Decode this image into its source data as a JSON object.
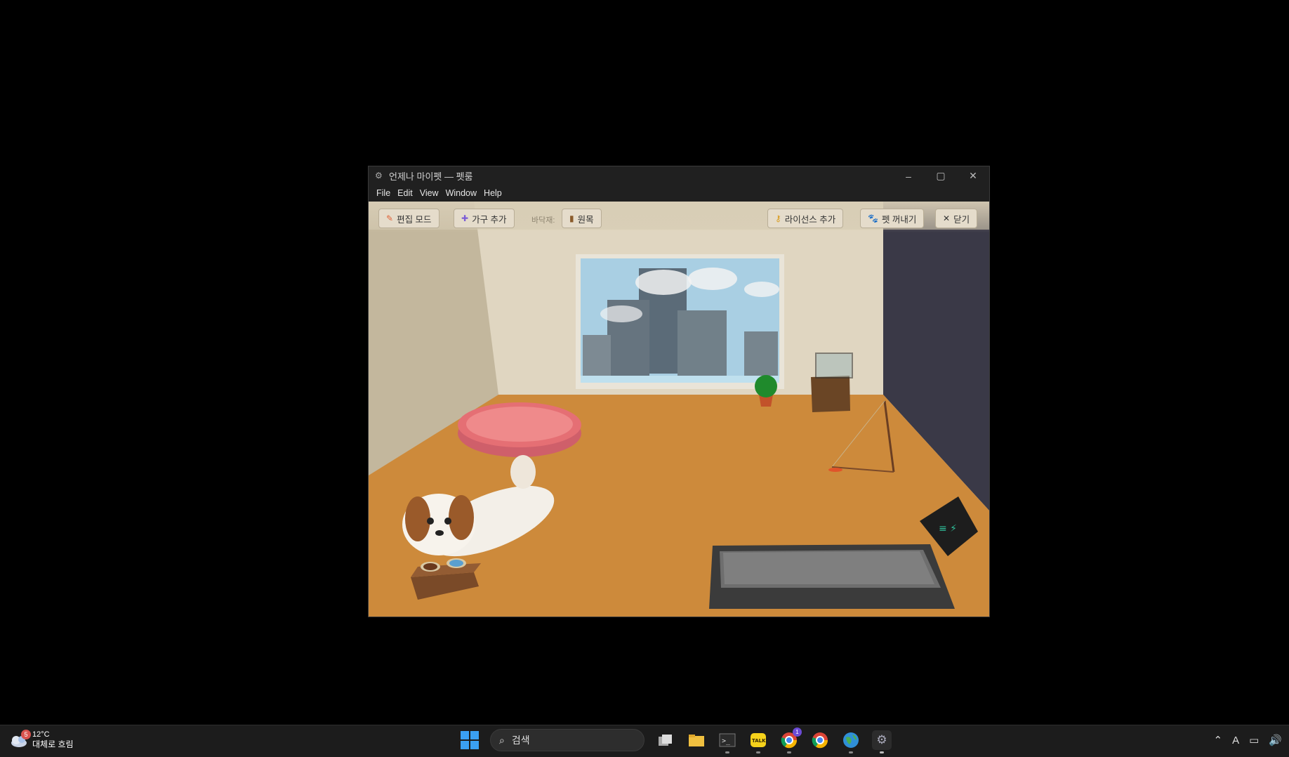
{
  "window": {
    "title": "언제나 마이펫 — 펫룸",
    "menu": [
      "File",
      "Edit",
      "View",
      "Window",
      "Help"
    ],
    "controls": {
      "minimize": "–",
      "maximize": "▢",
      "close": "✕"
    }
  },
  "toolbar": {
    "edit_mode": "편집 모드",
    "add_furniture": "가구 추가",
    "floor_label": "바닥재:",
    "floor_value": "원목",
    "add_license": "라이선스 추가",
    "take_out_pet": "펫 꺼내기",
    "close": "닫기"
  },
  "taskbar": {
    "weather_badge": "5",
    "temperature": "12°C",
    "weather_desc": "대체로 흐림",
    "search_placeholder": "검색",
    "chrome_badge": "1",
    "ime": "A"
  },
  "colors": {
    "floor": "#cf8a3a",
    "wall_left": "#c8bda4",
    "wall_back": "#e2d8c3",
    "wall_right": "#3b3b4a",
    "bed": "#e06b70",
    "accent": "#3aa0f3"
  }
}
